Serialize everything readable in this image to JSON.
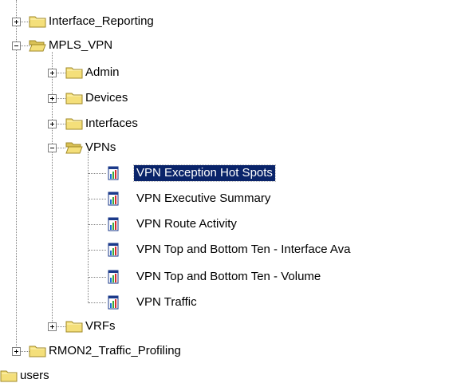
{
  "tree": {
    "interface_reporting": "Interface_Reporting",
    "mpls_vpn": "MPLS_VPN",
    "admin": "Admin",
    "devices": "Devices",
    "interfaces": "Interfaces",
    "vpns": "VPNs",
    "reports": [
      "VPN Exception Hot Spots",
      "VPN Executive Summary",
      "VPN Route Activity",
      "VPN Top and Bottom Ten - Interface Ava",
      "VPN Top and Bottom Ten - Volume",
      "VPN Traffic"
    ],
    "vrfs": "VRFs",
    "rmon2": "RMON2_Traffic_Profiling",
    "users": "users"
  },
  "selected_item": "VPN Exception Hot Spots",
  "icons": {
    "expand": "plus-box-icon",
    "collapse": "minus-box-icon",
    "closed_folder": "folder-closed-icon",
    "open_folder": "folder-open-icon",
    "report": "report-chart-icon"
  },
  "colors": {
    "selection": "#0a246a",
    "folder": "#f4df7a",
    "folder_edge": "#a08a28",
    "tree_lines": "#808080"
  }
}
